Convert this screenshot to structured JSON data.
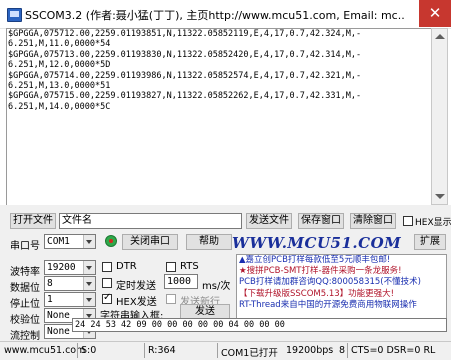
{
  "window": {
    "title": "SSCOM3.2 (作者:聂小猛(丁丁), 主页http://www.mcu51.com,  Email: mc...",
    "close_glyph": "✕"
  },
  "receive": {
    "lines": [
      "$GPGGA,075712.00,2259.01193851,N,11322.05852119,E,4,17,0.7,42.324,M,-",
      "6.251,M,11.0,0000*54",
      "$GPGGA,075713.00,2259.01193830,N,11322.05852420,E,4,17,0.7,42.314,M,-",
      "6.251,M,12.0,0000*5D",
      "$GPGGA,075714.00,2259.01193986,N,11322.05852574,E,4,17,0.7,42.321,M,-",
      "6.251,M,13.0,0000*51",
      "$GPGGA,075715.00,2259.01193827,N,11322.05852262,E,4,17,0.7,42.331,M,-",
      "6.251,M,14.0,0000*5C"
    ]
  },
  "toolbar": {
    "open_file": "打开文件",
    "file_name": "文件名",
    "send_file": "发送文件",
    "save_window": "保存窗口",
    "clear_window": "清除窗口",
    "hex_display": "HEX显示",
    "port_label": "串口号",
    "port_value": "COM1",
    "close_port": "关闭串口",
    "help": "帮助",
    "logo": "WWW.MCU51.COM",
    "expand": "扩展"
  },
  "settings": {
    "baud_label": "波特率",
    "baud_value": "19200",
    "databits_label": "数据位",
    "databits_value": "8",
    "stopbits_label": "停止位",
    "stopbits_value": "1",
    "parity_label": "校验位",
    "parity_value": "None",
    "flow_label": "流控制",
    "flow_value": "None",
    "dtr_label": "DTR",
    "rts_label": "RTS",
    "timed_send_label": "定时发送",
    "interval_value": "1000",
    "interval_unit": "ms/次",
    "hex_send_label": "HEX发送",
    "send_newline_label": "发送新行",
    "input_label": "字符串输入框:",
    "send_button": "发送",
    "send_text": "24 24 53 42 09 00 00 00 00 00 04 00 00 00"
  },
  "ads": [
    "▲嘉立创PCB打样每款低至5元顺丰包邮!",
    "★搜拼PCB-SMT打样-器件采购一条龙服务!",
    "PCB打样请加群咨询QQ:800058315(不懂技术)",
    "【下载升级版SSCOM5.13】功能更强大!",
    "RT-Thread来自中国的开源免费商用物联网操作"
  ],
  "status": {
    "site": "www.mcu51.com",
    "s_count": "S:0",
    "r_count": "R:364",
    "port_status": "COM1已打开",
    "baud_status": "19200bps",
    "bits_status": "8",
    "signals": "CTS=0 DSR=0 RL"
  },
  "colors": {
    "close_red": "#c7372f",
    "logo_blue": "#1a2f9a",
    "port_icon_green": "#2fa84a",
    "port_icon_red": "#d4291f"
  }
}
